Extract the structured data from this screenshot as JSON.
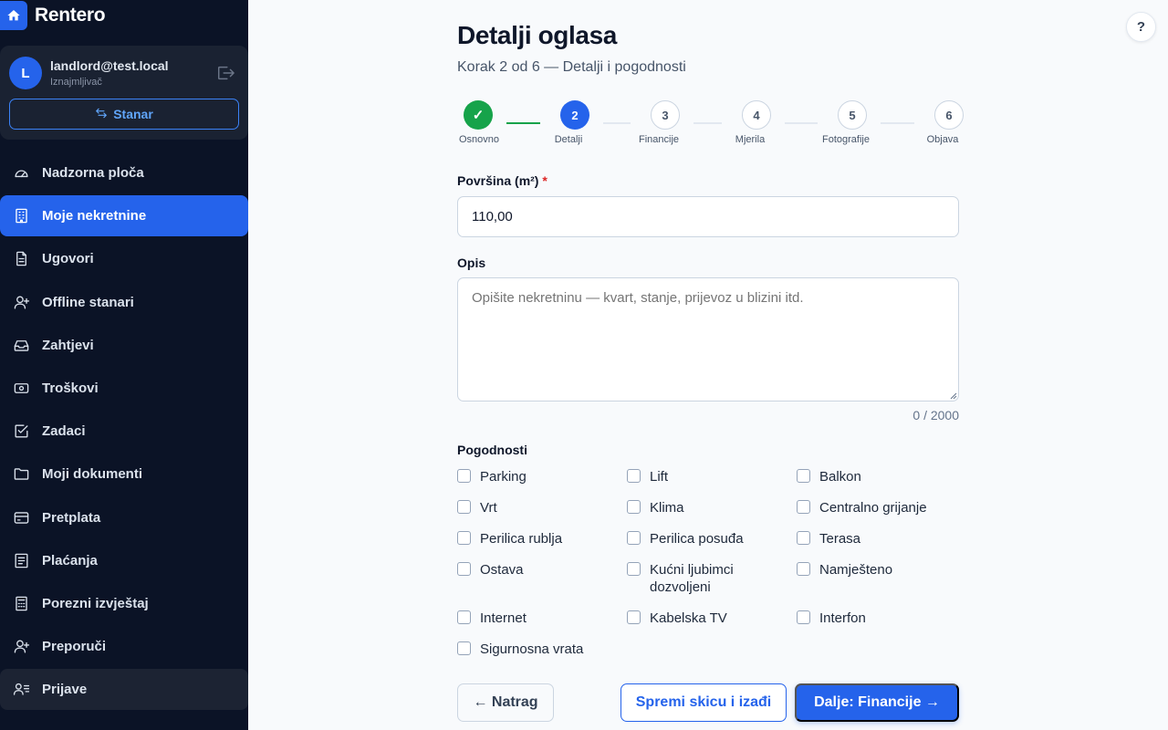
{
  "brand": {
    "name": "Rentero"
  },
  "user": {
    "initial": "L",
    "email": "landlord@test.local",
    "role": "Iznajmljivač",
    "switch_label": "Stanar"
  },
  "nav": {
    "items": [
      {
        "label": "Nadzorna ploča",
        "icon": "gauge-icon"
      },
      {
        "label": "Moje nekretnine",
        "icon": "building-icon"
      },
      {
        "label": "Ugovori",
        "icon": "document-icon"
      },
      {
        "label": "Offline stanari",
        "icon": "user-plus-icon"
      },
      {
        "label": "Zahtjevi",
        "icon": "inbox-icon"
      },
      {
        "label": "Troškovi",
        "icon": "banknote-icon"
      },
      {
        "label": "Zadaci",
        "icon": "check-square-icon"
      },
      {
        "label": "Moji dokumenti",
        "icon": "folder-icon"
      },
      {
        "label": "Pretplata",
        "icon": "credit-card-icon"
      },
      {
        "label": "Plaćanja",
        "icon": "receipt-icon"
      },
      {
        "label": "Porezni izvještaj",
        "icon": "calculator-icon"
      },
      {
        "label": "Preporuči",
        "icon": "user-plus-icon"
      },
      {
        "label": "Prijave",
        "icon": "user-list-icon"
      }
    ],
    "active_index": 1,
    "hover_index": 12
  },
  "help": {
    "label": "?"
  },
  "page": {
    "title": "Detalji oglasa",
    "subtitle": "Korak 2 od 6 — Detalji i pogodnosti"
  },
  "stepper": {
    "steps": [
      {
        "number": "✓",
        "label": "Osnovno",
        "state": "done"
      },
      {
        "number": "2",
        "label": "Detalji",
        "state": "current"
      },
      {
        "number": "3",
        "label": "Financije",
        "state": "todo"
      },
      {
        "number": "4",
        "label": "Mjerila",
        "state": "todo"
      },
      {
        "number": "5",
        "label": "Fotografije",
        "state": "todo"
      },
      {
        "number": "6",
        "label": "Objava",
        "state": "todo"
      }
    ]
  },
  "form": {
    "area": {
      "label": "Površina (m²)",
      "required_mark": "*",
      "value": "110,00"
    },
    "description": {
      "label": "Opis",
      "placeholder": "Opišite nekretninu — kvart, stanje, prijevoz u blizini itd.",
      "value": "",
      "counter": "0 / 2000"
    },
    "amenities": {
      "label": "Pogodnosti",
      "items": [
        {
          "label": "Parking",
          "checked": false
        },
        {
          "label": "Lift",
          "checked": false
        },
        {
          "label": "Balkon",
          "checked": false
        },
        {
          "label": "Vrt",
          "checked": false
        },
        {
          "label": "Klima",
          "checked": false
        },
        {
          "label": "Centralno grijanje",
          "checked": false
        },
        {
          "label": "Perilica rublja",
          "checked": false
        },
        {
          "label": "Perilica posuđa",
          "checked": false
        },
        {
          "label": "Terasa",
          "checked": false
        },
        {
          "label": "Ostava",
          "checked": false
        },
        {
          "label": "Kućni ljubimci dozvoljeni",
          "checked": false
        },
        {
          "label": "Namješteno",
          "checked": false
        },
        {
          "label": "Internet",
          "checked": false
        },
        {
          "label": "Kabelska TV",
          "checked": false
        },
        {
          "label": "Interfon",
          "checked": false
        },
        {
          "label": "Sigurnosna vrata",
          "checked": false
        }
      ]
    }
  },
  "actions": {
    "back": "← Natrag",
    "save_draft": "Spremi skicu i izađi",
    "next": "Dalje: Financije →"
  },
  "colors": {
    "accent": "#2563eb",
    "success": "#16a34a",
    "sidebar_bg": "#0b1326",
    "required": "#dc2626"
  }
}
